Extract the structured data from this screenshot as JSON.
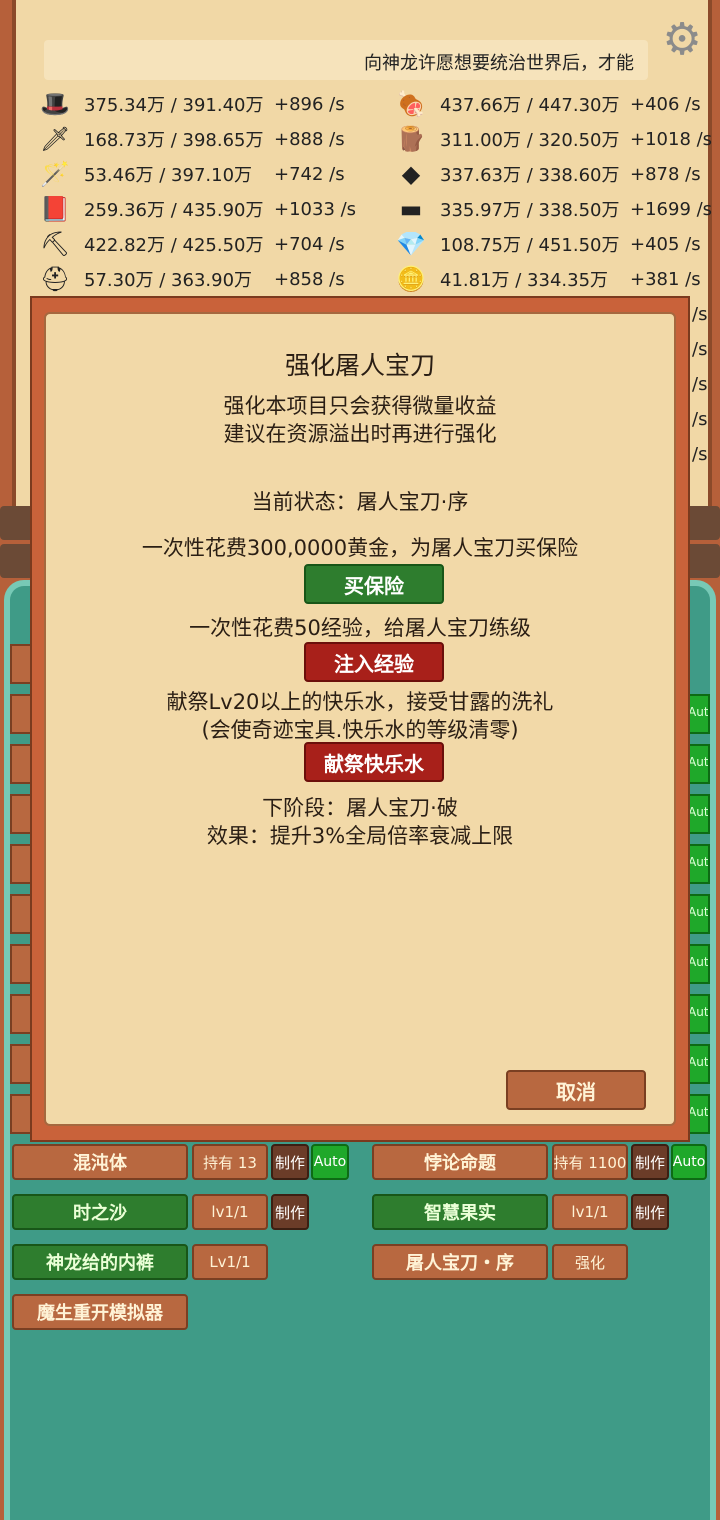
{
  "ticker": {
    "text": "向神龙许愿想要统治世界后，才能"
  },
  "icons": {
    "settings": "gear-icon"
  },
  "resources_left": [
    {
      "icon": "wizard-hat-icon",
      "glyph": "🎩",
      "value": "375.34万 / 391.40万",
      "rate": "+896 /s"
    },
    {
      "icon": "sword-icon",
      "glyph": "🗡",
      "value": "168.73万 / 398.65万",
      "rate": "+888 /s"
    },
    {
      "icon": "wand-icon",
      "glyph": "🪄",
      "value": "53.46万 / 397.10万",
      "rate": "+742 /s"
    },
    {
      "icon": "book-icon",
      "glyph": "📕",
      "value": "259.36万 / 435.90万",
      "rate": "+1033 /s"
    },
    {
      "icon": "pickaxe-icon",
      "glyph": "⛏",
      "value": "422.82万 / 425.50万",
      "rate": "+704 /s"
    },
    {
      "icon": "helmet-icon",
      "glyph": "⛑",
      "value": "57.30万 / 363.90万",
      "rate": "+858 /s"
    }
  ],
  "resources_right": [
    {
      "icon": "meat-icon",
      "glyph": "🍖",
      "value": "437.66万 / 447.30万",
      "rate": "+406 /s"
    },
    {
      "icon": "wood-icon",
      "glyph": "🪵",
      "value": "311.00万 / 320.50万",
      "rate": "+1018 /s"
    },
    {
      "icon": "stone-icon",
      "glyph": "◆",
      "value": "337.63万 / 338.60万",
      "rate": "+878 /s"
    },
    {
      "icon": "iron-icon",
      "glyph": "▬",
      "value": "335.97万 / 338.50万",
      "rate": "+1699 /s"
    },
    {
      "icon": "crystal-icon",
      "glyph": "💎",
      "value": "108.75万 / 451.50万",
      "rate": "+405 /s"
    },
    {
      "icon": "gold-coin-icon",
      "glyph": "🪙",
      "value": "41.81万 / 334.35万",
      "rate": "+381 /s"
    }
  ],
  "side_stub": "/s",
  "dialog": {
    "title": "强化屠人宝刀",
    "subtitle1": "强化本项目只会获得微量收益",
    "subtitle2": "建议在资源溢出时再进行强化",
    "status": "当前状态：屠人宝刀·序",
    "insurance_text": "一次性花费300,0000黄金，为屠人宝刀买保险",
    "insurance_button": "买保险",
    "exp_text": "一次性花费50经验，给屠人宝刀练级",
    "exp_button": "注入经验",
    "sacrifice_text1": "献祭Lv20以上的快乐水，接受甘露的洗礼",
    "sacrifice_text2": "(会使奇迹宝具.快乐水的等级清零)",
    "sacrifice_button": "献祭快乐水",
    "next_stage": "下阶段：屠人宝刀·破",
    "effect": "效果：提升3%全局倍率衰减上限",
    "cancel": "取消"
  },
  "edge_auto_label": "Auto",
  "items": {
    "chaos": {
      "name": "混沌体",
      "hold": "持有 13",
      "make": "制作",
      "auto": "Auto"
    },
    "paradox": {
      "name": "悖论命题",
      "hold": "持有 1100",
      "make": "制作",
      "auto": "Auto"
    },
    "sand": {
      "name": "时之沙",
      "level": "lv1/1",
      "make": "制作"
    },
    "wisdom": {
      "name": "智慧果实",
      "level": "lv1/1",
      "make": "制作"
    },
    "pants": {
      "name": "神龙给的内裤",
      "level": "Lv1/1"
    },
    "blade": {
      "name": "屠人宝刀・序",
      "action": "强化"
    },
    "simulator": {
      "name": "魔生重开模拟器"
    }
  }
}
